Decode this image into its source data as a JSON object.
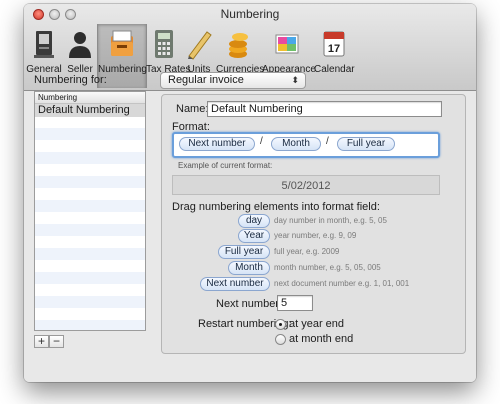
{
  "window": {
    "title": "Numbering"
  },
  "toolbar": {
    "items": [
      {
        "label": "General",
        "icon": "general-icon"
      },
      {
        "label": "Seller",
        "icon": "seller-icon"
      },
      {
        "label": "Numbering",
        "icon": "numbering-icon"
      },
      {
        "label": "Tax Rates",
        "icon": "calculator-icon"
      },
      {
        "label": "Units",
        "icon": "ruler-icon"
      },
      {
        "label": "Currencies",
        "icon": "coins-icon"
      },
      {
        "label": "Appearance",
        "icon": "appearance-icon"
      },
      {
        "label": "Calendar",
        "icon": "calendar-icon"
      }
    ],
    "selected": "Numbering",
    "calendar_day": "17"
  },
  "numbering_for": {
    "label": "Numbering for:",
    "value": "Regular invoice"
  },
  "list": {
    "header": "Numbering",
    "items": [
      "Default Numbering"
    ]
  },
  "name": {
    "label": "Name:",
    "value": "Default Numbering"
  },
  "format": {
    "label": "Format:",
    "tokens": [
      "Next number",
      "Month",
      "Full year"
    ],
    "separator": "/"
  },
  "example": {
    "label": "Example of current format:",
    "value": "5/02/2012"
  },
  "drag": {
    "label": "Drag numbering elements into format field:",
    "elements": [
      {
        "token": "day",
        "desc": "day number in month, e.g. 5, 05"
      },
      {
        "token": "Year",
        "desc": "year number, e.g. 9, 09"
      },
      {
        "token": "Full year",
        "desc": "full year, e.g. 2009"
      },
      {
        "token": "Month",
        "desc": "month number, e.g. 5, 05, 005"
      },
      {
        "token": "Next number",
        "desc": "next document number e.g. 1, 01, 001"
      }
    ]
  },
  "next_number": {
    "label": "Next number:",
    "value": "5"
  },
  "restart": {
    "label": "Restart numbering:",
    "options": [
      "at year end",
      "at month end"
    ],
    "selected": "at year end"
  },
  "buttons": {
    "add": "+",
    "remove": "−"
  },
  "colors": {
    "focus": "#6b9fdb",
    "close": "#d0372a"
  }
}
